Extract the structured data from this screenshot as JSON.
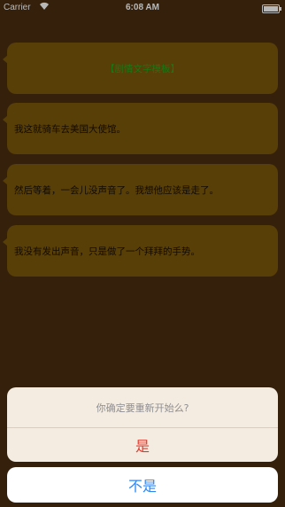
{
  "status_bar": {
    "carrier": "Carrier",
    "time": "6:08 AM"
  },
  "messages": [
    {
      "text": "【剧情文字模板】",
      "color": "#23a51d"
    },
    {
      "text": "我这就骑车去美国大使馆。"
    },
    {
      "text": "然后等着，一会儿没声音了。我想他应该是走了。"
    },
    {
      "text": "我没有发出声音，只是做了一个拜拜的手势。"
    }
  ],
  "action_sheet": {
    "title": "你确定要重新开始么?",
    "confirm_label": "是",
    "cancel_label": "不是",
    "confirm_color": "#e23b30",
    "cancel_color": "#2a87f5"
  }
}
